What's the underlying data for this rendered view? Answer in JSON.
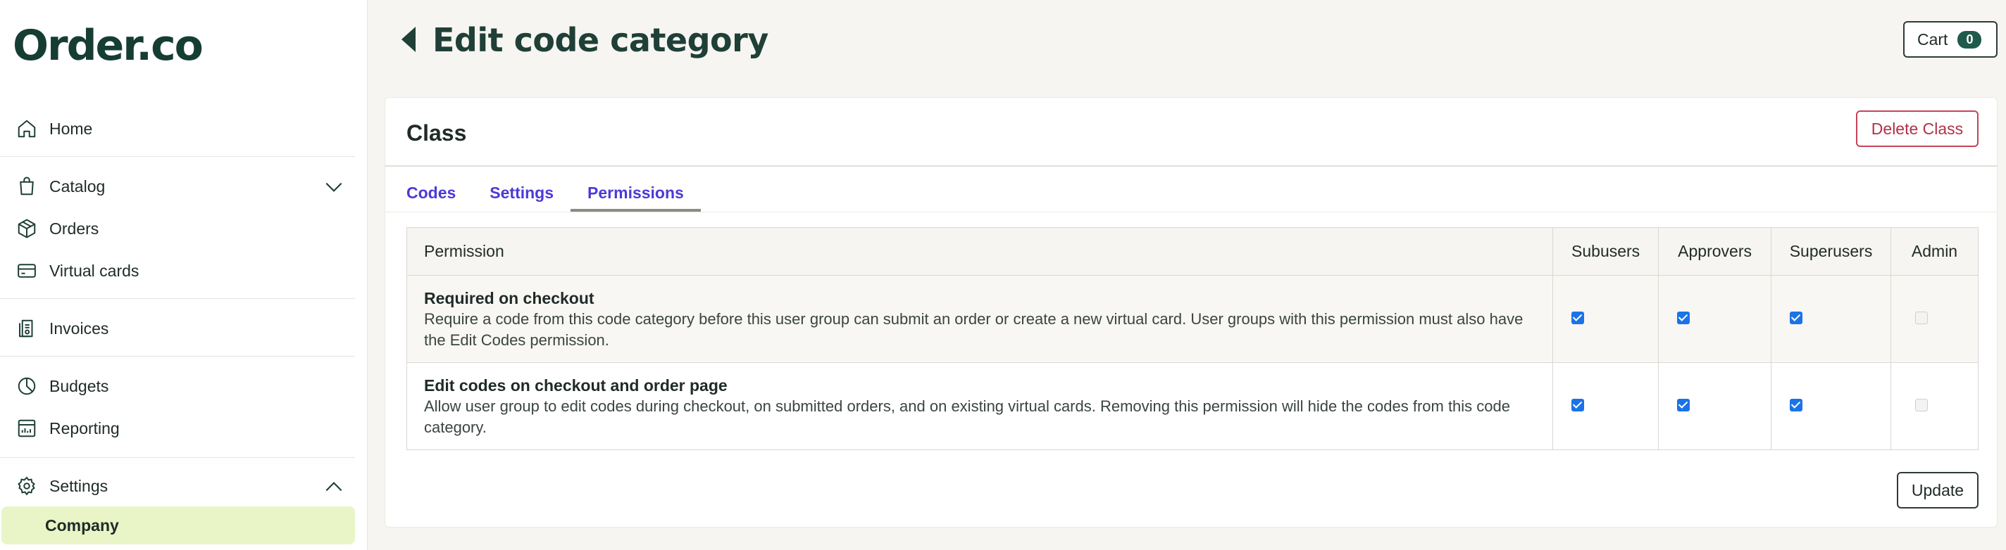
{
  "app": {
    "logo": "Order.co"
  },
  "sidebar": {
    "items": [
      {
        "label": "Home",
        "icon": "home-icon"
      },
      {
        "label": "Catalog",
        "icon": "shopping-bag-icon",
        "expanded": false
      },
      {
        "label": "Orders",
        "icon": "box-icon"
      },
      {
        "label": "Virtual cards",
        "icon": "credit-card-icon"
      },
      {
        "label": "Invoices",
        "icon": "invoice-icon"
      },
      {
        "label": "Budgets",
        "icon": "pie-chart-icon"
      },
      {
        "label": "Reporting",
        "icon": "report-icon"
      },
      {
        "label": "Settings",
        "icon": "gear-icon",
        "expanded": true
      }
    ],
    "active_subitem": "Company"
  },
  "header": {
    "title": "Edit code category",
    "cart_label": "Cart",
    "cart_count": "0"
  },
  "card": {
    "title": "Class",
    "delete_label": "Delete Class",
    "tabs": [
      {
        "label": "Codes",
        "active": false
      },
      {
        "label": "Settings",
        "active": false
      },
      {
        "label": "Permissions",
        "active": true
      }
    ],
    "table": {
      "headers": [
        "Permission",
        "Subusers",
        "Approvers",
        "Superusers",
        "Admin"
      ],
      "rows": [
        {
          "title": "Required on checkout",
          "description": "Require a code from this code category before this user group can submit an order or create a new virtual card. User groups with this permission must also have the Edit Codes permission.",
          "subusers": true,
          "approvers": true,
          "superusers": true,
          "admin": false
        },
        {
          "title": "Edit codes on checkout and order page",
          "description": "Allow user group to edit codes during checkout, on submitted orders, and on existing virtual cards. Removing this permission will hide the codes from this code category.",
          "subusers": true,
          "approvers": true,
          "superusers": true,
          "admin": false
        }
      ]
    },
    "update_label": "Update"
  },
  "colors": {
    "brand": "#163d33",
    "tab_link": "#4b3ad6",
    "danger": "#b03149",
    "active_nav_bg": "#e9f5c6",
    "checkbox": "#1a73e8"
  }
}
